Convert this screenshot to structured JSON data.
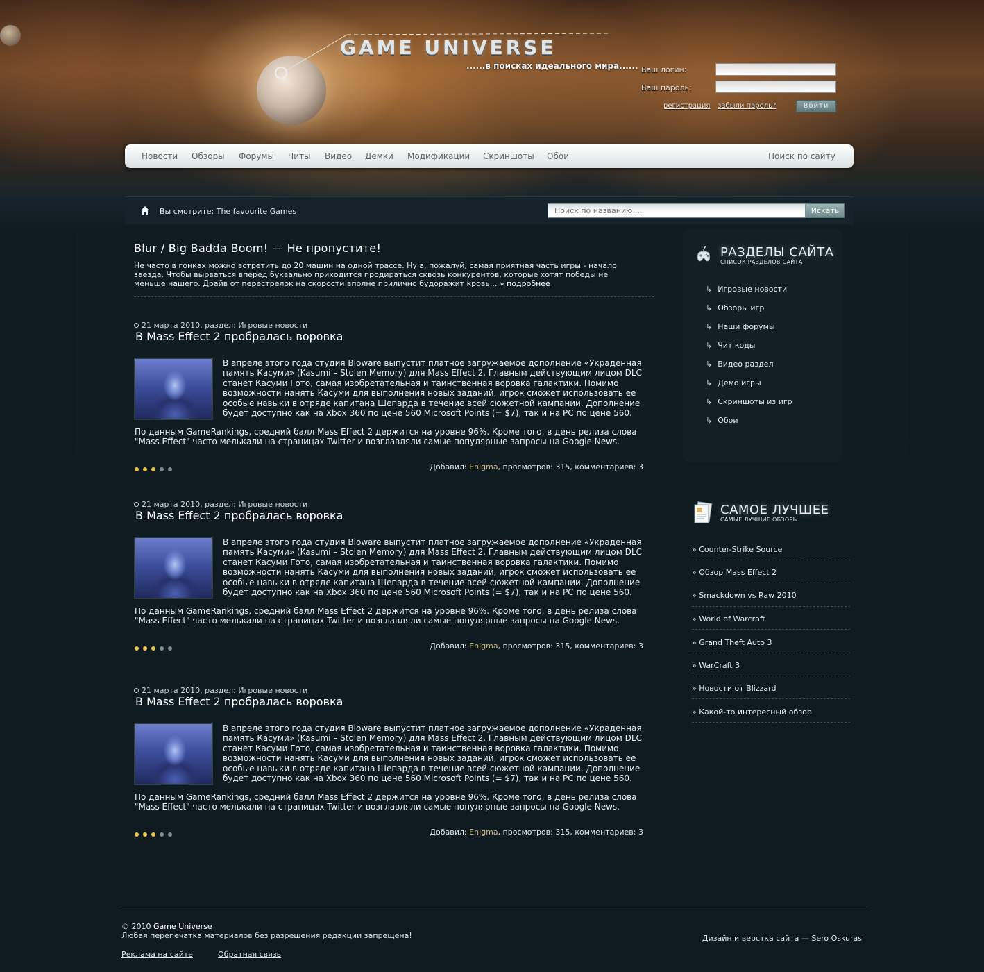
{
  "site": {
    "logo_text": "GAME UNIVERSE",
    "slogan": "......в поисках идеального мира......"
  },
  "login": {
    "login_label": "Ваш логин:",
    "password_label": "Ваш пароль:",
    "register_link": "регистрация",
    "forgot_link": "забыли пароль?",
    "submit_label": "Войти",
    "login_value": "",
    "password_value": ""
  },
  "nav": {
    "items": [
      "Новости",
      "Обзоры",
      "Форумы",
      "Читы",
      "Видео",
      "Демки",
      "Модификации",
      "Скриншоты",
      "Обои"
    ],
    "search_label": "Поиск по сайту"
  },
  "breadcrumb": {
    "text": "Вы смотрите: The favourite Games",
    "search_placeholder": "Поиск по названию ...",
    "search_button": "Искать"
  },
  "featured": {
    "title": "Blur / Big Badda Boom! — Не пропустите!",
    "text": "Не часто в гонках можно встретить до 20 машин на одной трассе. Ну а, пожалуй, самая приятная часть игры - начало заезда. Чтобы вырваться вперед буквально приходится продираться сквозь конкурентов, которые хотят победы не меньше нашего. Драйв от перестрелок на скорости вполне прилично будоражит кровь... »",
    "more_link": "подробнее"
  },
  "articles": [
    {
      "meta": "21 марта 2010, раздел: Игровые новости",
      "title": "В Mass Effect 2 пробралась воровка",
      "text": "В апреле этого года студия Bioware выпустит платное загружаемое дополнение «Украденная память Касуми» (Kasumi – Stolen Memory) для Mass Effect 2. Главным действующим лицом DLC станет Касуми Гото, самая изобретательная и таинственная воровка галактики. Помимо возможности нанять Касуми для выполнения новых заданий, игрок сможет использовать ее особые навыки в отряде капитана Шепарда в течение всей сюжетной кампании. Дополнение будет доступно как на Xbox 360 по цене 560 Microsoft Points (= $7), так и на PC по цене 560.",
      "text2": "По данным GameRankings, средний балл Mass Effect 2 держится на уровне 96%. Кроме того, в день релиза слова \"Mass Effect\" часто мелькали на страницах Twitter и возглавляли самые популярные запросы на Google News.",
      "rating": 3,
      "rating_max": 5,
      "added_label": "Добавил:",
      "author": "Enigma",
      "stats_tail": ", просмотров: 315, комментариев: 3"
    },
    {
      "meta": "21 марта 2010, раздел: Игровые новости",
      "title": "В Mass Effect 2 пробралась воровка",
      "text": "В апреле этого года студия Bioware выпустит платное загружаемое дополнение «Украденная память Касуми» (Kasumi – Stolen Memory) для Mass Effect 2. Главным действующим лицом DLC станет Касуми Гото, самая изобретательная и таинственная воровка галактики. Помимо возможности нанять Касуми для выполнения новых заданий, игрок сможет использовать ее особые навыки в отряде капитана Шепарда в течение всей сюжетной кампании. Дополнение будет доступно как на Xbox 360 по цене 560 Microsoft Points (= $7), так и на PC по цене 560.",
      "text2": "По данным GameRankings, средний балл Mass Effect 2 держится на уровне 96%. Кроме того, в день релиза слова \"Mass Effect\" часто мелькали на страницах Twitter и возглавляли самые популярные запросы на Google News.",
      "rating": 3,
      "rating_max": 5,
      "added_label": "Добавил:",
      "author": "Enigma",
      "stats_tail": ", просмотров: 315, комментариев: 3"
    },
    {
      "meta": "21 марта 2010, раздел: Игровые новости",
      "title": "В Mass Effect 2 пробралась воровка",
      "text": "В апреле этого года студия Bioware выпустит платное загружаемое дополнение «Украденная память Касуми» (Kasumi – Stolen Memory) для Mass Effect 2. Главным действующим лицом DLC станет Касуми Гото, самая изобретательная и таинственная воровка галактики. Помимо возможности нанять Касуми для выполнения новых заданий, игрок сможет использовать ее особые навыки в отряде капитана Шепарда в течение всей сюжетной кампании. Дополнение будет доступно как на Xbox 360 по цене 560 Microsoft Points (= $7), так и на PC по цене 560.",
      "text2": "По данным GameRankings, средний балл Mass Effect 2 держится на уровне 96%. Кроме того, в день релиза слова \"Mass Effect\" часто мелькали на страницах Twitter и возглавляли самые популярные запросы на Google News.",
      "rating": 3,
      "rating_max": 5,
      "added_label": "Добавил:",
      "author": "Enigma",
      "stats_tail": ", просмотров: 315, комментариев: 3"
    }
  ],
  "sidebar": {
    "sections": {
      "title": "РАЗДЕЛЫ САЙТА",
      "subtitle": "СПИСОК РАЗДЕЛОВ САЙТА",
      "icon": "joystick-icon",
      "items": [
        "Игровые новости",
        "Обзоры игр",
        "Наши форумы",
        "Чит коды",
        "Видео раздел",
        "Демо игры",
        "Скриншоты из игр",
        "Обои"
      ]
    },
    "best": {
      "title": "САМОЕ ЛУЧШЕЕ",
      "subtitle": "САМЫЕ ЛУЧШИЕ ОБЗОРЫ",
      "icon": "document-icon",
      "items": [
        "» Counter-Strike Source",
        "» Обзор Mass Effect 2",
        "» Smackdown vs Raw 2010",
        "» World of Warcraft",
        "» Grand Theft Auto 3",
        "» WarCraft 3",
        "» Новости от Blizzard",
        "» Какой-то интересный обзор"
      ]
    }
  },
  "footer": {
    "copyright_prefix": "© 2010",
    "copyright_site": "Game Universe",
    "notice": "Любая перепечатка материалов без разрешения редакции запрещена!",
    "ads_link": "Реклама на сайте",
    "feedback_link": "Обратная связь",
    "design_credit": "Дизайн и верстка сайта — Sero Oskuras"
  },
  "colors": {
    "background": "#0d1a1f",
    "rating_on": "#e9c34a",
    "rating_off": "#7d8e92",
    "author": "#cbb77a",
    "button": "#6d8a8b"
  }
}
